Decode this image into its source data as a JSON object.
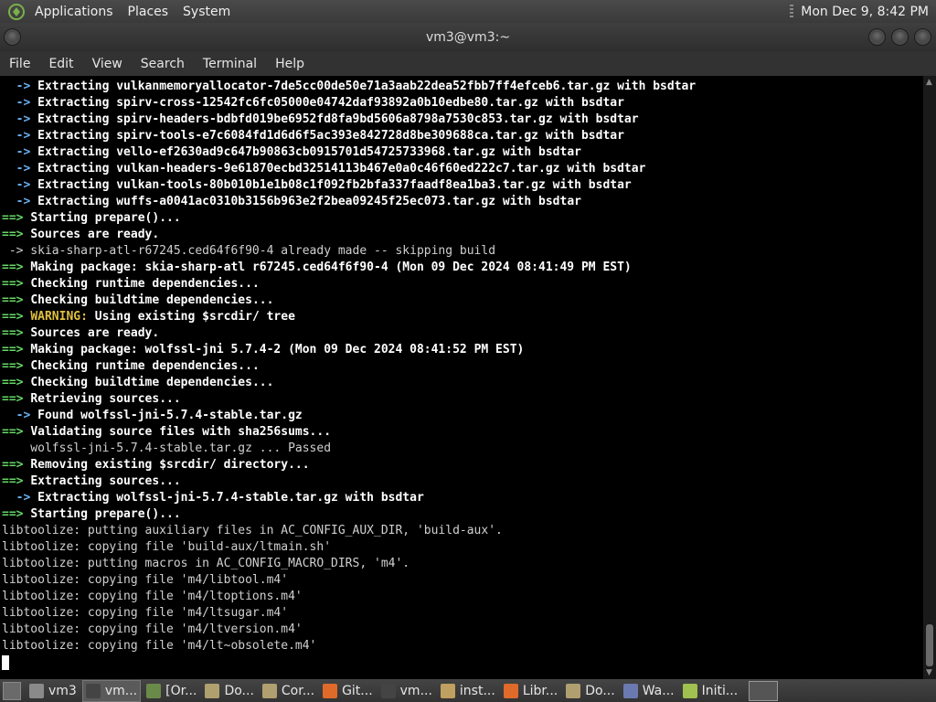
{
  "top_panel": {
    "menus": [
      "Applications",
      "Places",
      "System"
    ],
    "clock": "Mon Dec 9,  8:42 PM"
  },
  "window": {
    "title": "vm3@vm3:~"
  },
  "menubar": {
    "items": [
      "File",
      "Edit",
      "View",
      "Search",
      "Terminal",
      "Help"
    ]
  },
  "terminal": {
    "lines": [
      [
        [
          "arr",
          "  -> "
        ],
        [
          "b",
          "Extracting vulkanmemoryallocator-7de5cc00de50e71a3aab22dea52fbb7ff4efceb6.tar.gz with bsdtar"
        ]
      ],
      [
        [
          "arr",
          "  -> "
        ],
        [
          "b",
          "Extracting spirv-cross-12542fc6fc05000e04742daf93892a0b10edbe80.tar.gz with bsdtar"
        ]
      ],
      [
        [
          "arr",
          "  -> "
        ],
        [
          "b",
          "Extracting spirv-headers-bdbfd019be6952fd8fa9bd5606a8798a7530c853.tar.gz with bsdtar"
        ]
      ],
      [
        [
          "arr",
          "  -> "
        ],
        [
          "b",
          "Extracting spirv-tools-e7c6084fd1d6d6f5ac393e842728d8be309688ca.tar.gz with bsdtar"
        ]
      ],
      [
        [
          "arr",
          "  -> "
        ],
        [
          "b",
          "Extracting vello-ef2630ad9c647b90863cb0915701d54725733968.tar.gz with bsdtar"
        ]
      ],
      [
        [
          "arr",
          "  -> "
        ],
        [
          "b",
          "Extracting vulkan-headers-9e61870ecbd32514113b467e0a0c46f60ed222c7.tar.gz with bsdtar"
        ]
      ],
      [
        [
          "arr",
          "  -> "
        ],
        [
          "b",
          "Extracting vulkan-tools-80b010b1e1b08c1f092fb2bfa337faadf8ea1ba3.tar.gz with bsdtar"
        ]
      ],
      [
        [
          "arr",
          "  -> "
        ],
        [
          "b",
          "Extracting wuffs-a0041ac0310b3156b963e2f2bea09245f25ec073.tar.gz with bsdtar"
        ]
      ],
      [
        [
          "ok",
          "==> "
        ],
        [
          "b",
          "Starting prepare()..."
        ]
      ],
      [
        [
          "ok",
          "==> "
        ],
        [
          "b",
          "Sources are ready."
        ]
      ],
      [
        [
          "n",
          " -> skia-sharp-atl-r67245.ced64f6f90-4 already made -- skipping build"
        ]
      ],
      [
        [
          "ok",
          "==> "
        ],
        [
          "b",
          "Making package: skia-sharp-atl r67245.ced64f6f90-4 (Mon 09 Dec 2024 08:41:49 PM EST)"
        ]
      ],
      [
        [
          "ok",
          "==> "
        ],
        [
          "b",
          "Checking runtime dependencies..."
        ]
      ],
      [
        [
          "ok",
          "==> "
        ],
        [
          "b",
          "Checking buildtime dependencies..."
        ]
      ],
      [
        [
          "ok",
          "==> "
        ],
        [
          "w",
          "WARNING:"
        ],
        [
          "b",
          " Using existing $srcdir/ tree"
        ]
      ],
      [
        [
          "ok",
          "==> "
        ],
        [
          "b",
          "Sources are ready."
        ]
      ],
      [
        [
          "ok",
          "==> "
        ],
        [
          "b",
          "Making package: wolfssl-jni 5.7.4-2 (Mon 09 Dec 2024 08:41:52 PM EST)"
        ]
      ],
      [
        [
          "ok",
          "==> "
        ],
        [
          "b",
          "Checking runtime dependencies..."
        ]
      ],
      [
        [
          "ok",
          "==> "
        ],
        [
          "b",
          "Checking buildtime dependencies..."
        ]
      ],
      [
        [
          "ok",
          "==> "
        ],
        [
          "b",
          "Retrieving sources..."
        ]
      ],
      [
        [
          "arr",
          "  -> "
        ],
        [
          "b",
          "Found wolfssl-jni-5.7.4-stable.tar.gz"
        ]
      ],
      [
        [
          "ok",
          "==> "
        ],
        [
          "b",
          "Validating source files with sha256sums..."
        ]
      ],
      [
        [
          "n",
          "    wolfssl-jni-5.7.4-stable.tar.gz ... Passed"
        ]
      ],
      [
        [
          "ok",
          "==> "
        ],
        [
          "b",
          "Removing existing $srcdir/ directory..."
        ]
      ],
      [
        [
          "ok",
          "==> "
        ],
        [
          "b",
          "Extracting sources..."
        ]
      ],
      [
        [
          "arr",
          "  -> "
        ],
        [
          "b",
          "Extracting wolfssl-jni-5.7.4-stable.tar.gz with bsdtar"
        ]
      ],
      [
        [
          "ok",
          "==> "
        ],
        [
          "b",
          "Starting prepare()..."
        ]
      ],
      [
        [
          "n",
          "libtoolize: putting auxiliary files in AC_CONFIG_AUX_DIR, 'build-aux'."
        ]
      ],
      [
        [
          "n",
          "libtoolize: copying file 'build-aux/ltmain.sh'"
        ]
      ],
      [
        [
          "n",
          "libtoolize: putting macros in AC_CONFIG_MACRO_DIRS, 'm4'."
        ]
      ],
      [
        [
          "n",
          "libtoolize: copying file 'm4/libtool.m4'"
        ]
      ],
      [
        [
          "n",
          "libtoolize: copying file 'm4/ltoptions.m4'"
        ]
      ],
      [
        [
          "n",
          "libtoolize: copying file 'm4/ltsugar.m4'"
        ]
      ],
      [
        [
          "n",
          "libtoolize: copying file 'm4/ltversion.m4'"
        ]
      ],
      [
        [
          "n",
          "libtoolize: copying file 'm4/lt~obsolete.m4'"
        ]
      ]
    ]
  },
  "taskbar": {
    "items": [
      {
        "label": "vm3",
        "icon": "home-folder-icon",
        "color": "#8a8a8a"
      },
      {
        "label": "vm...",
        "icon": "terminal-icon",
        "color": "#444444"
      },
      {
        "label": "[Or...",
        "icon": "script-icon",
        "color": "#6a8a4a"
      },
      {
        "label": "Do...",
        "icon": "folder-icon",
        "color": "#b0a070"
      },
      {
        "label": "Cor...",
        "icon": "folder-icon",
        "color": "#b0a070"
      },
      {
        "label": "Git...",
        "icon": "firefox-icon",
        "color": "#e06a2a"
      },
      {
        "label": "vm...",
        "icon": "terminal-icon",
        "color": "#444444"
      },
      {
        "label": "inst...",
        "icon": "text-editor-icon",
        "color": "#c0a060"
      },
      {
        "label": "Libr...",
        "icon": "firefox-icon",
        "color": "#e06a2a"
      },
      {
        "label": "Do...",
        "icon": "folder-icon",
        "color": "#b0a070"
      },
      {
        "label": "Wa...",
        "icon": "window-icon",
        "color": "#6a7ab0"
      },
      {
        "label": "Initi...",
        "icon": "app-icon",
        "color": "#a0c050"
      }
    ]
  }
}
